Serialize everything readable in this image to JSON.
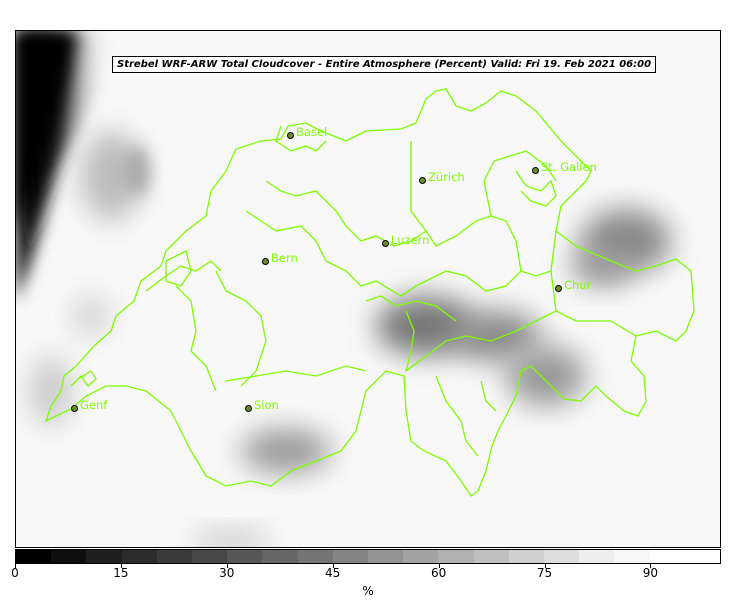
{
  "title": "Strebel WRF-ARW Total Cloudcover - Entire Atmosphere (Percent)   Valid: Fri 19. Feb 2021 06:00",
  "cities": [
    {
      "name": "Basel",
      "dot": [
        290,
        135
      ]
    },
    {
      "name": "Zürich",
      "dot": [
        422,
        180
      ]
    },
    {
      "name": "St. Gallen",
      "dot": [
        535,
        170
      ]
    },
    {
      "name": "Luzern",
      "dot": [
        385,
        243
      ]
    },
    {
      "name": "Bern",
      "dot": [
        265,
        261
      ]
    },
    {
      "name": "Chur",
      "dot": [
        558,
        288
      ]
    },
    {
      "name": "Genf",
      "dot": [
        74,
        408
      ]
    },
    {
      "name": "Sion",
      "dot": [
        248,
        408
      ]
    }
  ],
  "colorbar": {
    "label": "%",
    "ticks": [
      "0",
      "15",
      "30",
      "45",
      "60",
      "75",
      "90"
    ],
    "tick_values": [
      0,
      15,
      30,
      45,
      60,
      75,
      90
    ],
    "min": 0,
    "max": 100,
    "colors": [
      "#000000",
      "#0e0e0e",
      "#1e1e1e",
      "#2c2c2c",
      "#3a3a3a",
      "#484848",
      "#575757",
      "#666666",
      "#757575",
      "#848484",
      "#939393",
      "#a2a2a2",
      "#b1b1b1",
      "#c0c0c0",
      "#cfcfcf",
      "#dedede",
      "#ededed",
      "#f7f7f7",
      "#ffffff",
      "#ffffff"
    ]
  },
  "colors": {
    "border": "#7cfc00",
    "label": "#7cfc00"
  }
}
